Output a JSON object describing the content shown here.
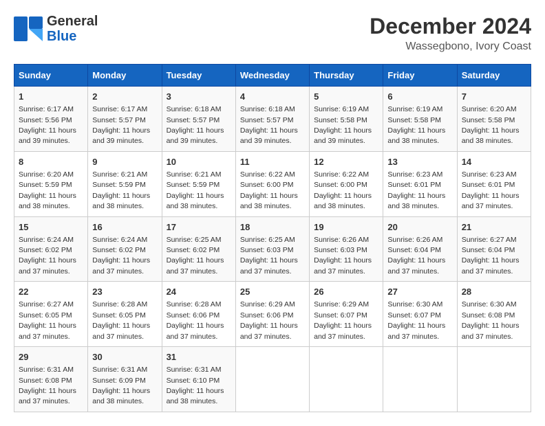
{
  "header": {
    "logo_line1": "General",
    "logo_line2": "Blue",
    "title": "December 2024",
    "subtitle": "Wassegbono, Ivory Coast"
  },
  "calendar": {
    "days_of_week": [
      "Sunday",
      "Monday",
      "Tuesday",
      "Wednesday",
      "Thursday",
      "Friday",
      "Saturday"
    ],
    "weeks": [
      [
        null,
        null,
        null,
        null,
        null,
        null,
        null
      ]
    ]
  },
  "cells": [
    {
      "day": "1",
      "col": 0,
      "sunrise": "6:17 AM",
      "sunset": "5:56 PM",
      "daylight": "11 hours and 39 minutes."
    },
    {
      "day": "2",
      "col": 1,
      "sunrise": "6:17 AM",
      "sunset": "5:57 PM",
      "daylight": "11 hours and 39 minutes."
    },
    {
      "day": "3",
      "col": 2,
      "sunrise": "6:18 AM",
      "sunset": "5:57 PM",
      "daylight": "11 hours and 39 minutes."
    },
    {
      "day": "4",
      "col": 3,
      "sunrise": "6:18 AM",
      "sunset": "5:57 PM",
      "daylight": "11 hours and 39 minutes."
    },
    {
      "day": "5",
      "col": 4,
      "sunrise": "6:19 AM",
      "sunset": "5:58 PM",
      "daylight": "11 hours and 39 minutes."
    },
    {
      "day": "6",
      "col": 5,
      "sunrise": "6:19 AM",
      "sunset": "5:58 PM",
      "daylight": "11 hours and 38 minutes."
    },
    {
      "day": "7",
      "col": 6,
      "sunrise": "6:20 AM",
      "sunset": "5:58 PM",
      "daylight": "11 hours and 38 minutes."
    },
    {
      "day": "8",
      "col": 0,
      "sunrise": "6:20 AM",
      "sunset": "5:59 PM",
      "daylight": "11 hours and 38 minutes."
    },
    {
      "day": "9",
      "col": 1,
      "sunrise": "6:21 AM",
      "sunset": "5:59 PM",
      "daylight": "11 hours and 38 minutes."
    },
    {
      "day": "10",
      "col": 2,
      "sunrise": "6:21 AM",
      "sunset": "5:59 PM",
      "daylight": "11 hours and 38 minutes."
    },
    {
      "day": "11",
      "col": 3,
      "sunrise": "6:22 AM",
      "sunset": "6:00 PM",
      "daylight": "11 hours and 38 minutes."
    },
    {
      "day": "12",
      "col": 4,
      "sunrise": "6:22 AM",
      "sunset": "6:00 PM",
      "daylight": "11 hours and 38 minutes."
    },
    {
      "day": "13",
      "col": 5,
      "sunrise": "6:23 AM",
      "sunset": "6:01 PM",
      "daylight": "11 hours and 38 minutes."
    },
    {
      "day": "14",
      "col": 6,
      "sunrise": "6:23 AM",
      "sunset": "6:01 PM",
      "daylight": "11 hours and 37 minutes."
    },
    {
      "day": "15",
      "col": 0,
      "sunrise": "6:24 AM",
      "sunset": "6:02 PM",
      "daylight": "11 hours and 37 minutes."
    },
    {
      "day": "16",
      "col": 1,
      "sunrise": "6:24 AM",
      "sunset": "6:02 PM",
      "daylight": "11 hours and 37 minutes."
    },
    {
      "day": "17",
      "col": 2,
      "sunrise": "6:25 AM",
      "sunset": "6:02 PM",
      "daylight": "11 hours and 37 minutes."
    },
    {
      "day": "18",
      "col": 3,
      "sunrise": "6:25 AM",
      "sunset": "6:03 PM",
      "daylight": "11 hours and 37 minutes."
    },
    {
      "day": "19",
      "col": 4,
      "sunrise": "6:26 AM",
      "sunset": "6:03 PM",
      "daylight": "11 hours and 37 minutes."
    },
    {
      "day": "20",
      "col": 5,
      "sunrise": "6:26 AM",
      "sunset": "6:04 PM",
      "daylight": "11 hours and 37 minutes."
    },
    {
      "day": "21",
      "col": 6,
      "sunrise": "6:27 AM",
      "sunset": "6:04 PM",
      "daylight": "11 hours and 37 minutes."
    },
    {
      "day": "22",
      "col": 0,
      "sunrise": "6:27 AM",
      "sunset": "6:05 PM",
      "daylight": "11 hours and 37 minutes."
    },
    {
      "day": "23",
      "col": 1,
      "sunrise": "6:28 AM",
      "sunset": "6:05 PM",
      "daylight": "11 hours and 37 minutes."
    },
    {
      "day": "24",
      "col": 2,
      "sunrise": "6:28 AM",
      "sunset": "6:06 PM",
      "daylight": "11 hours and 37 minutes."
    },
    {
      "day": "25",
      "col": 3,
      "sunrise": "6:29 AM",
      "sunset": "6:06 PM",
      "daylight": "11 hours and 37 minutes."
    },
    {
      "day": "26",
      "col": 4,
      "sunrise": "6:29 AM",
      "sunset": "6:07 PM",
      "daylight": "11 hours and 37 minutes."
    },
    {
      "day": "27",
      "col": 5,
      "sunrise": "6:30 AM",
      "sunset": "6:07 PM",
      "daylight": "11 hours and 37 minutes."
    },
    {
      "day": "28",
      "col": 6,
      "sunrise": "6:30 AM",
      "sunset": "6:08 PM",
      "daylight": "11 hours and 37 minutes."
    },
    {
      "day": "29",
      "col": 0,
      "sunrise": "6:31 AM",
      "sunset": "6:08 PM",
      "daylight": "11 hours and 37 minutes."
    },
    {
      "day": "30",
      "col": 1,
      "sunrise": "6:31 AM",
      "sunset": "6:09 PM",
      "daylight": "11 hours and 38 minutes."
    },
    {
      "day": "31",
      "col": 2,
      "sunrise": "6:31 AM",
      "sunset": "6:10 PM",
      "daylight": "11 hours and 38 minutes."
    }
  ]
}
